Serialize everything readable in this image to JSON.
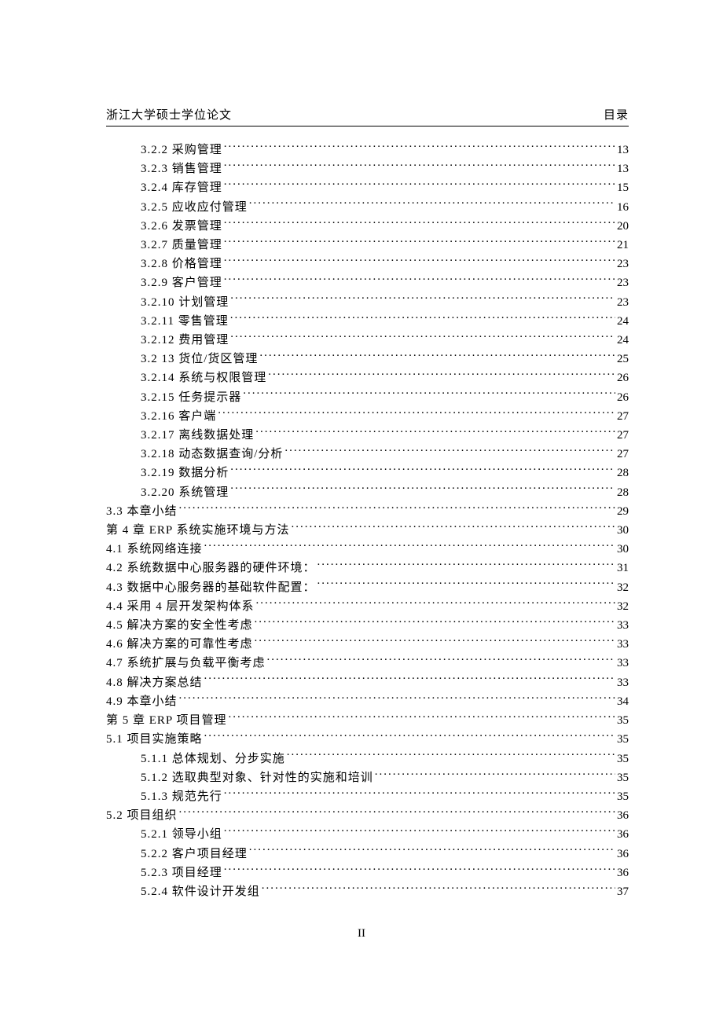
{
  "header": {
    "left": "浙江大学硕士学位论文",
    "right": "目录"
  },
  "page_number": "II",
  "toc": [
    {
      "num": "3.2.2",
      "title": "采购管理",
      "page": "13",
      "level": 2
    },
    {
      "num": "3.2.3",
      "title": "销售管理",
      "page": "13",
      "level": 2
    },
    {
      "num": "3.2.4",
      "title": "库存管理",
      "page": "15",
      "level": 2
    },
    {
      "num": "3.2.5",
      "title": "应收应付管理",
      "page": "16",
      "level": 2
    },
    {
      "num": "3.2.6",
      "title": "发票管理",
      "page": "20",
      "level": 2
    },
    {
      "num": "3.2.7",
      "title": "质量管理",
      "page": "21",
      "level": 2
    },
    {
      "num": "3.2.8",
      "title": "价格管理",
      "page": "23",
      "level": 2
    },
    {
      "num": "3.2.9",
      "title": "客户管理",
      "page": "23",
      "level": 2
    },
    {
      "num": "3.2.10",
      "title": "计划管理",
      "page": "23",
      "level": 2
    },
    {
      "num": "3.2.11",
      "title": "零售管理",
      "page": "24",
      "level": 2
    },
    {
      "num": "3.2.12",
      "title": "费用管理",
      "page": "24",
      "level": 2
    },
    {
      "num": "3.2 13",
      "title": "货位/货区管理",
      "page": "25",
      "level": 2
    },
    {
      "num": "3.2.14",
      "title": "系统与权限管理",
      "page": "26",
      "level": 2
    },
    {
      "num": "3.2.15",
      "title": "任务提示器",
      "page": "26",
      "level": 2
    },
    {
      "num": "3.2.16",
      "title": "客户端",
      "page": "27",
      "level": 2
    },
    {
      "num": "3.2.17",
      "title": "离线数据处理",
      "page": "27",
      "level": 2
    },
    {
      "num": "3.2.18",
      "title": "动态数据查询/分析",
      "page": "27",
      "level": 2
    },
    {
      "num": "3.2.19",
      "title": "数据分析",
      "page": "28",
      "level": 2
    },
    {
      "num": "3.2.20",
      "title": "系统管理",
      "page": "28",
      "level": 2
    },
    {
      "num": "3.3",
      "title": "本章小结",
      "page": "29",
      "level": 1
    },
    {
      "num": "第 4 章",
      "title": "ERP 系统实施环境与方法",
      "page": "30",
      "level": 1
    },
    {
      "num": "4.1",
      "title": "系统网络连接",
      "page": "30",
      "level": 1
    },
    {
      "num": "4.2",
      "title": "系统数据中心服务器的硬件环境：",
      "page": "31",
      "level": 1
    },
    {
      "num": "4.3",
      "title": "数据中心服务器的基础软件配置：",
      "page": "32",
      "level": 1
    },
    {
      "num": "4.4",
      "title": "采用 4 层开发架构体系",
      "page": "32",
      "level": 1
    },
    {
      "num": "4.5",
      "title": "解决方案的安全性考虑",
      "page": "33",
      "level": 1
    },
    {
      "num": "4.6",
      "title": "解决方案的可靠性考虑",
      "page": "33",
      "level": 1
    },
    {
      "num": "4.7",
      "title": "系统扩展与负载平衡考虑",
      "page": "33",
      "level": 1
    },
    {
      "num": "4.8",
      "title": "解决方案总结",
      "page": "33",
      "level": 1
    },
    {
      "num": "4.9",
      "title": "本章小结",
      "page": "34",
      "level": 1
    },
    {
      "num": "第 5 章",
      "title": "ERP 项目管理",
      "page": "35",
      "level": 1
    },
    {
      "num": "5.1",
      "title": "项目实施策略",
      "page": "35",
      "level": 1
    },
    {
      "num": "5.1.1",
      "title": "总体规划、分步实施",
      "page": "35",
      "level": 2
    },
    {
      "num": "5.1.2",
      "title": "选取典型对象、针对性的实施和培训",
      "page": "35",
      "level": 2
    },
    {
      "num": "5.1.3",
      "title": "规范先行",
      "page": "35",
      "level": 2
    },
    {
      "num": "5.2",
      "title": "项目组织",
      "page": "36",
      "level": 1
    },
    {
      "num": "5.2.1",
      "title": "领导小组",
      "page": "36",
      "level": 2
    },
    {
      "num": "5.2.2",
      "title": "客户项目经理",
      "page": "36",
      "level": 2
    },
    {
      "num": "5.2.3",
      "title": "项目经理",
      "page": "36",
      "level": 2
    },
    {
      "num": "5.2.4",
      "title": "软件设计开发组",
      "page": "37",
      "level": 2
    }
  ]
}
